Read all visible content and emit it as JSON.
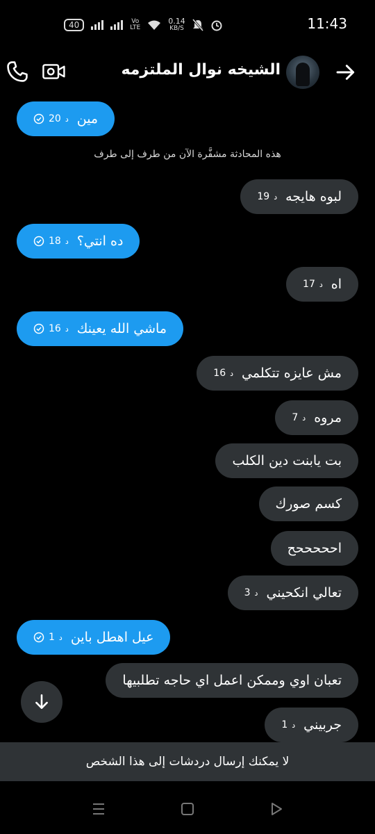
{
  "status_bar": {
    "battery": "40",
    "network_speed": "0.14",
    "network_unit": "KB/S",
    "volte_top": "Vo",
    "volte_bottom": "LTE",
    "time": "11:43"
  },
  "header": {
    "title": "الشيخه نوال الملتزمه"
  },
  "encryption_notice": "هذه المحادثة مشفَّرة الآن من طرف إلى طرف",
  "time_unit": "د",
  "messages": [
    {
      "dir": "sent",
      "text": "مين",
      "time": "20",
      "seen": true
    },
    {
      "dir": "recv",
      "text": "لبوه هايجه",
      "time": "19"
    },
    {
      "dir": "sent",
      "text": "ده انتي؟",
      "time": "18",
      "seen": true
    },
    {
      "dir": "recv",
      "text": "اه",
      "time": "17"
    },
    {
      "dir": "sent",
      "text": "ماشي الله يعينك",
      "time": "16",
      "seen": true
    },
    {
      "dir": "recv",
      "text": "مش عايزه تتكلمي",
      "time": "16"
    },
    {
      "dir": "recv",
      "text": "مروه",
      "time": "7"
    },
    {
      "dir": "recv",
      "text": "بت يابنت دين الكلب",
      "time": ""
    },
    {
      "dir": "recv",
      "text": "كسم صورك",
      "time": ""
    },
    {
      "dir": "recv",
      "text": "احححححح",
      "time": ""
    },
    {
      "dir": "recv",
      "text": "تعالي انكحيني",
      "time": "3"
    },
    {
      "dir": "sent",
      "text": "عيل اهطل باين",
      "time": "1",
      "seen": true
    },
    {
      "dir": "recv",
      "text": "تعبان اوي وممكن اعمل اي حاجه تطلبيها",
      "time": ""
    },
    {
      "dir": "recv",
      "text": "جربيني",
      "time": "1"
    }
  ],
  "blocked_message": "لا يمكنك إرسال دردشات إلى هذا الشخص",
  "colors": {
    "sent_bubble": "#1d9bf0",
    "received_bubble": "#2f3336",
    "background": "#000000"
  },
  "icons": {
    "call": "phone-icon",
    "video": "video-camera-icon",
    "back": "arrow-right-icon",
    "scroll": "arrow-down-icon",
    "seen": "check-circle-icon"
  }
}
